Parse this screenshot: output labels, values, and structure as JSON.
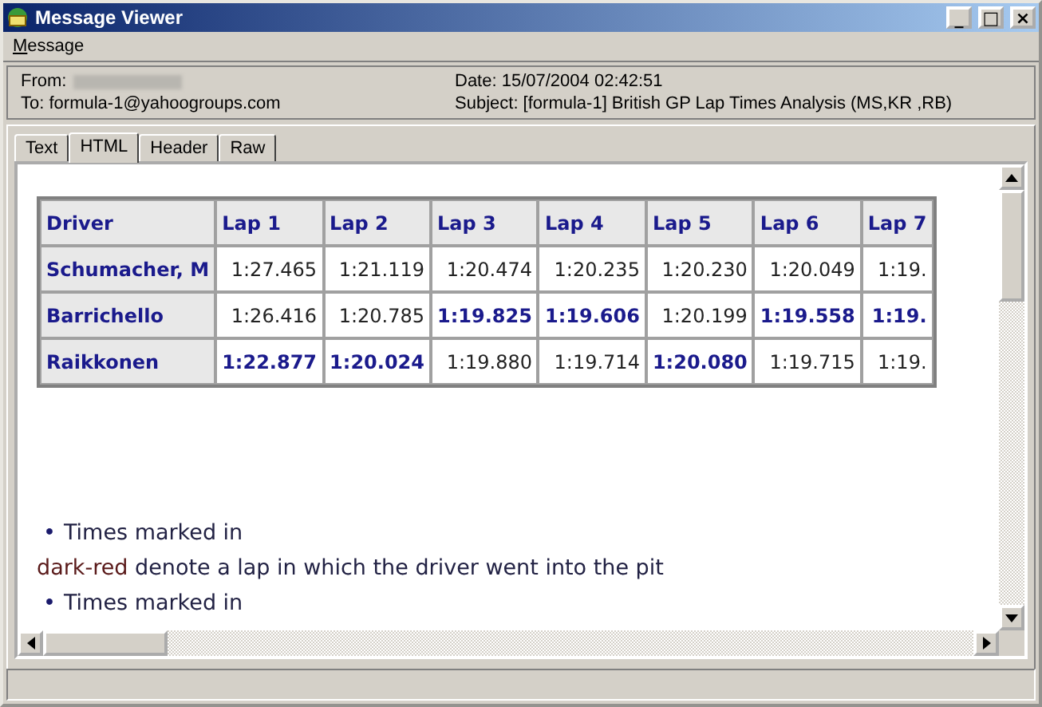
{
  "window": {
    "title": "Message Viewer",
    "controls": [
      "_",
      "□",
      "×"
    ]
  },
  "menu": [
    {
      "label": "Message"
    }
  ],
  "header": {
    "from_label": "From:",
    "date": "Date: 15/07/2004 02:42:51",
    "to": "To: formula-1@yahoogroups.com",
    "subject": "Subject: [formula-1] British GP Lap Times Analysis (MS,KR ,RB)"
  },
  "tabs": [
    {
      "label": "Text",
      "selected": false
    },
    {
      "label": "HTML",
      "selected": true
    },
    {
      "label": "Header",
      "selected": false
    },
    {
      "label": "Raw",
      "selected": false
    }
  ],
  "table": {
    "columns": [
      "Driver",
      "Lap 1",
      "Lap 2",
      "Lap 3",
      "Lap 4",
      "Lap 5",
      "Lap 6",
      "Lap 7"
    ],
    "rows": [
      {
        "cells": [
          {
            "kind": "driver",
            "text": "Schumacher, M"
          },
          {
            "kind": "time",
            "text": "1:27.465",
            "fastest": false
          },
          {
            "kind": "time",
            "text": "1:21.119",
            "fastest": false
          },
          {
            "kind": "time",
            "text": "1:20.474",
            "fastest": false
          },
          {
            "kind": "time",
            "text": "1:20.235",
            "fastest": false
          },
          {
            "kind": "time",
            "text": "1:20.230",
            "fastest": false
          },
          {
            "kind": "time",
            "text": "1:20.049",
            "fastest": false
          },
          {
            "kind": "time",
            "text": "1:19.",
            "fastest": false
          }
        ]
      },
      {
        "cells": [
          {
            "kind": "driver",
            "text": "Barrichello"
          },
          {
            "kind": "time",
            "text": "1:26.416",
            "fastest": false
          },
          {
            "kind": "time",
            "text": "1:20.785",
            "fastest": false
          },
          {
            "kind": "time",
            "text": "1:19.825",
            "fastest": true
          },
          {
            "kind": "time",
            "text": "1:19.606",
            "fastest": true
          },
          {
            "kind": "time",
            "text": "1:20.199",
            "fastest": false
          },
          {
            "kind": "time",
            "text": "1:19.558",
            "fastest": true
          },
          {
            "kind": "time",
            "text": "1:19.",
            "fastest": true
          }
        ]
      },
      {
        "cells": [
          {
            "kind": "driver",
            "text": "Raikkonen"
          },
          {
            "kind": "time",
            "text": "1:22.877",
            "fastest": true
          },
          {
            "kind": "time",
            "text": "1:20.024",
            "fastest": true
          },
          {
            "kind": "time",
            "text": "1:19.880",
            "fastest": false
          },
          {
            "kind": "time",
            "text": "1:19.714",
            "fastest": false
          },
          {
            "kind": "time",
            "text": "1:20.080",
            "fastest": true
          },
          {
            "kind": "time",
            "text": "1:19.715",
            "fastest": false
          },
          {
            "kind": "time",
            "text": "1:19.",
            "fastest": false
          }
        ]
      }
    ]
  },
  "notes": [
    {
      "kind": "bullet",
      "bullet": "•",
      "text": "Times marked in"
    },
    {
      "kind": "line",
      "lead": "dark-red",
      "text": "denote a lap in which the driver went into the pit"
    },
    {
      "kind": "bullet",
      "bullet": "•",
      "text": "Times marked in"
    }
  ]
}
